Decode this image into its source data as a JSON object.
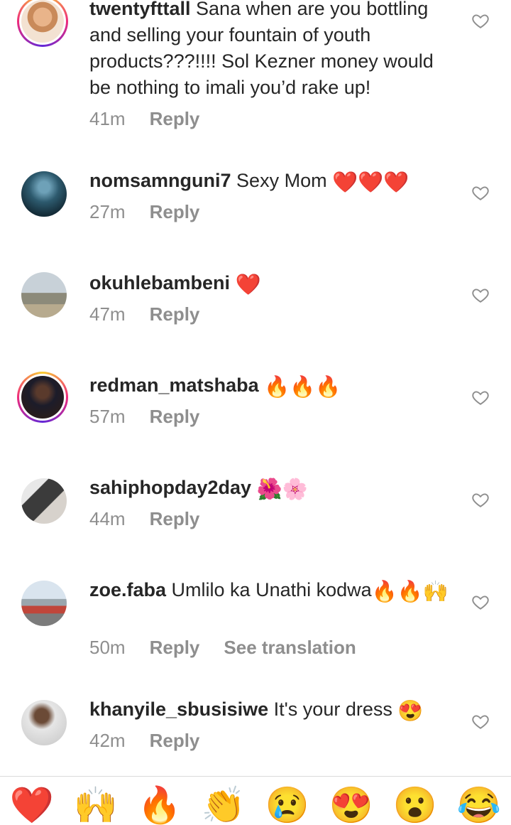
{
  "comments": [
    {
      "username": "twentyfttall",
      "text": "Sana when are you bottling and selling your fountain of youth products???!!!! Sol Kezner money would be nothing to imali you’d rake up!",
      "time": "41m",
      "reply": "Reply"
    },
    {
      "username": "nomsamnguni7",
      "text": "Sexy Mom",
      "emojis": "❤️❤️❤️",
      "time": "27m",
      "reply": "Reply"
    },
    {
      "username": "okuhlebambeni",
      "text": "",
      "emojis": "❤️",
      "time": "47m",
      "reply": "Reply"
    },
    {
      "username": "redman_matshaba",
      "text": "",
      "emojis": "🔥🔥🔥",
      "time": "57m",
      "reply": "Reply"
    },
    {
      "username": "sahiphopday2day",
      "text": "",
      "emojis": "🌺🌸",
      "time": "44m",
      "reply": "Reply"
    },
    {
      "username": "zoe.faba",
      "text": "Umlilo ka Unathi kodwa",
      "emojis": "🔥🔥🙌",
      "time": "50m",
      "reply": "Reply",
      "translate": "See translation"
    },
    {
      "username": "khanyile_sbusisiwe",
      "text": "It's your dress",
      "emojis": "😍",
      "time": "42m",
      "reply": "Reply"
    }
  ],
  "reactions": [
    "❤️",
    "🙌",
    "🔥",
    "👏",
    "😢",
    "😍",
    "😮",
    "😂"
  ],
  "colors": {
    "text": "#262626",
    "muted": "#8e8e8e",
    "divider": "#dbdbdb"
  },
  "icons": {
    "like": "heart-outline-icon"
  }
}
